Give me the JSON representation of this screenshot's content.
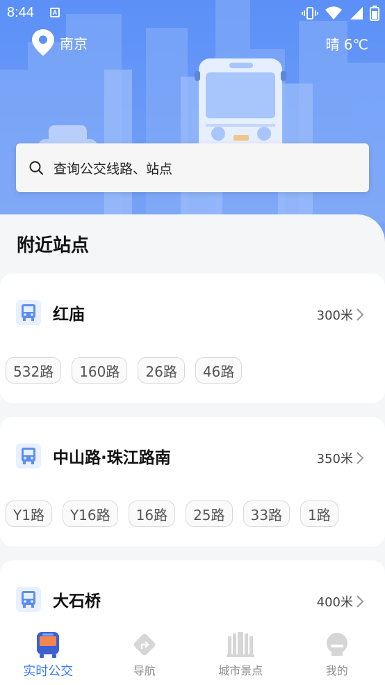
{
  "status_bar": {
    "time": "8:44",
    "app_icon": "A"
  },
  "header": {
    "city": "南京",
    "weather": "晴 6℃"
  },
  "search": {
    "placeholder": "查询公交线路、站点"
  },
  "section_title": "附近站点",
  "stops": [
    {
      "name": "红庙",
      "distance": "300米",
      "routes": [
        "532路",
        "160路",
        "26路",
        "46路"
      ]
    },
    {
      "name": "中山路·珠江路南",
      "distance": "350米",
      "routes": [
        "Y1路",
        "Y16路",
        "16路",
        "25路",
        "33路",
        "1路"
      ]
    },
    {
      "name": "大石桥",
      "distance": "400米",
      "routes": []
    }
  ],
  "nav": {
    "items": [
      {
        "label": "实时公交",
        "icon": "bus-icon",
        "active": true
      },
      {
        "label": "导航",
        "icon": "navigation-icon",
        "active": false
      },
      {
        "label": "城市景点",
        "icon": "landmark-icon",
        "active": false
      },
      {
        "label": "我的",
        "icon": "profile-icon",
        "active": false
      }
    ]
  },
  "colors": {
    "accent": "#3d7cf5",
    "hero": "#5b90f7"
  }
}
